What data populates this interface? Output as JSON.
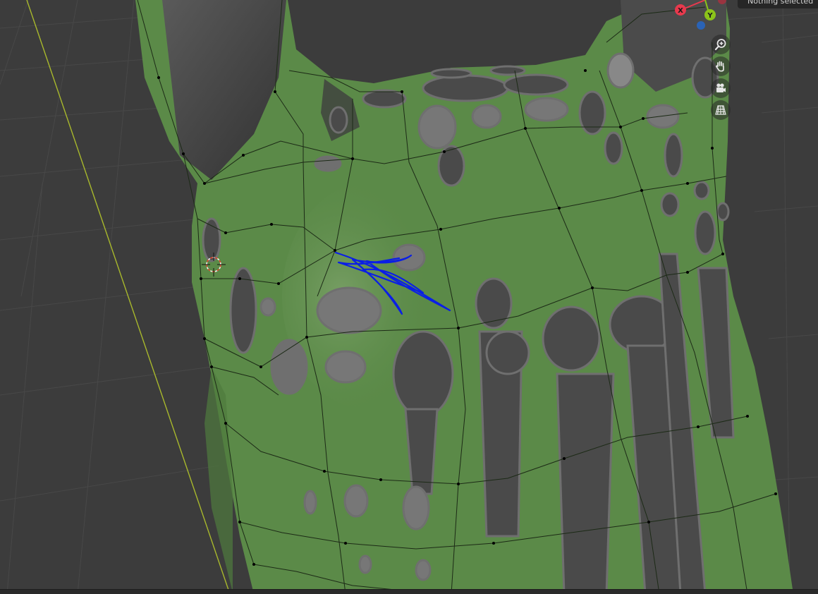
{
  "viewport": {
    "status_text": "Nothing selected"
  },
  "gizmo": {
    "x_label": "X",
    "y_label": "Y",
    "colors": {
      "x": "#e8394d",
      "y": "#8bc31a",
      "z": "#2a63b6",
      "neg_x": "#9a3440"
    }
  },
  "nav_buttons": [
    {
      "name": "zoom-button",
      "icon": "magnifier-plus-icon"
    },
    {
      "name": "pan-button",
      "icon": "hand-icon"
    },
    {
      "name": "camera-view-button",
      "icon": "camera-icon"
    },
    {
      "name": "perspective-toggle-button",
      "icon": "grid-perspective-icon"
    }
  ],
  "colors": {
    "background": "#3c3c3c",
    "grid_line": "#474747",
    "y_axis_line": "#a8b82c",
    "mesh_green": "#5b8a48",
    "mesh_dark": "#4a4a4a",
    "spot_outline": "#6c6c6c",
    "stroke_blue": "#0a1ee6"
  }
}
